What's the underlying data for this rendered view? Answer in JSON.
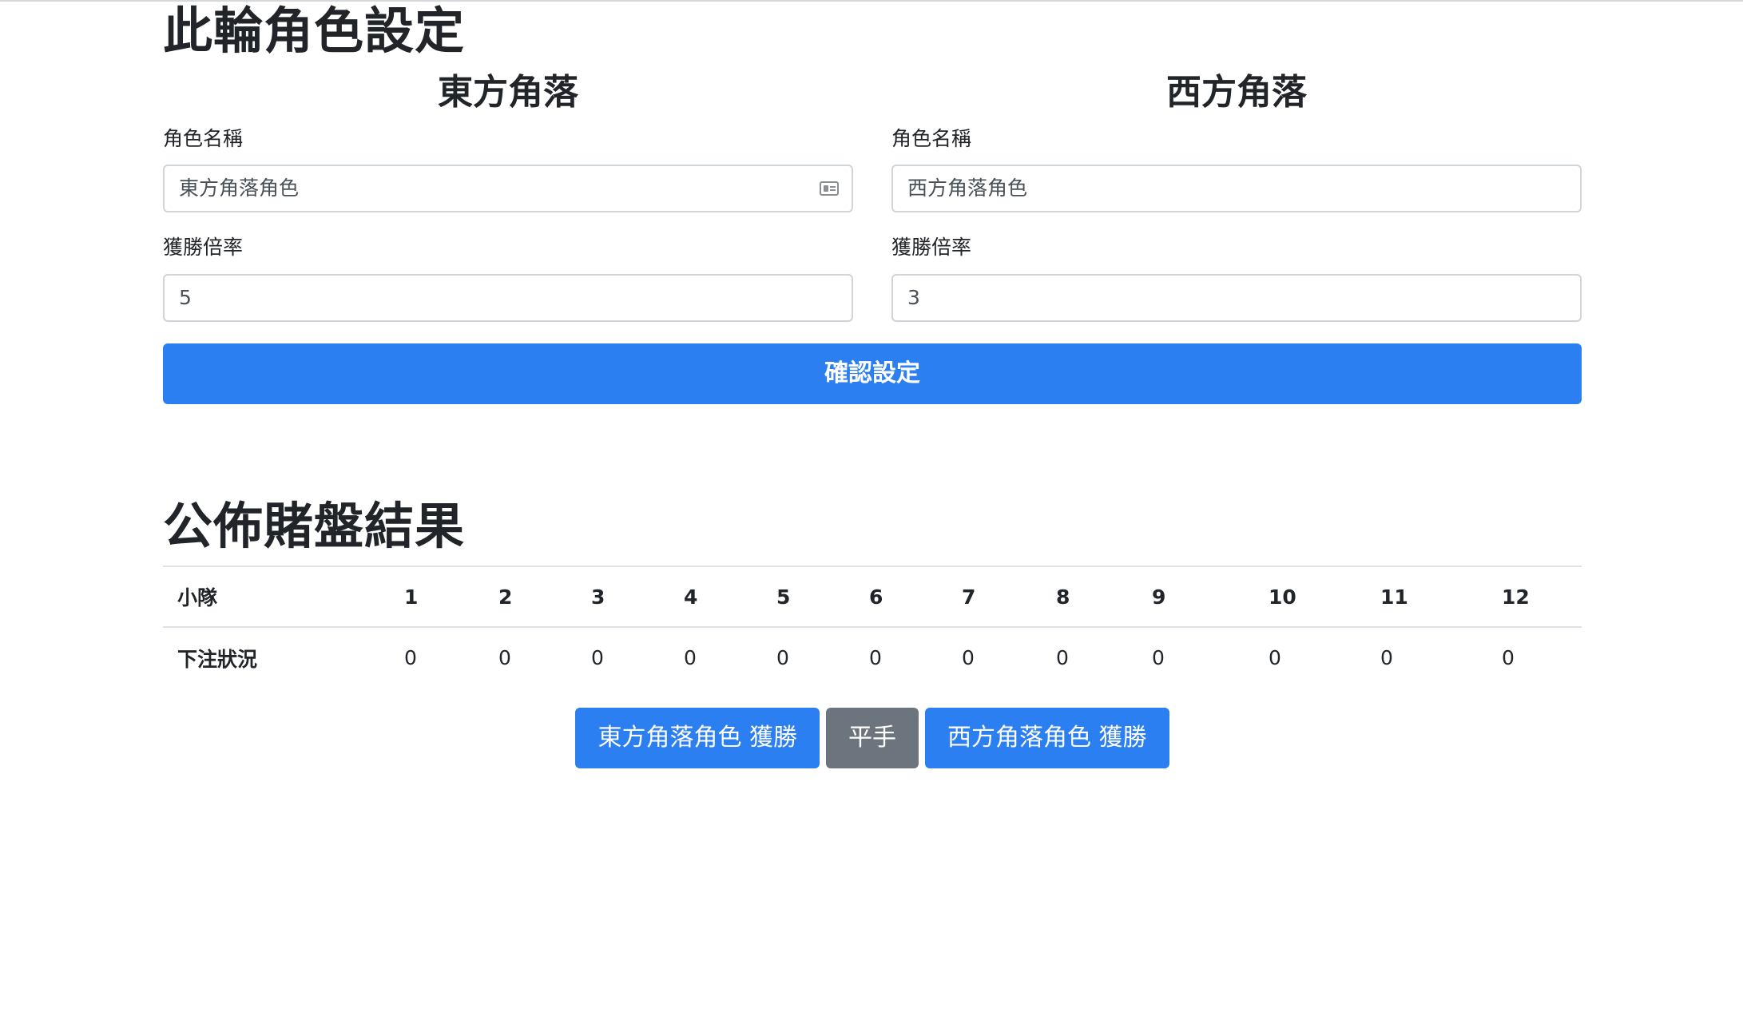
{
  "settings": {
    "title": "此輪角色設定",
    "confirm_label": "確認設定"
  },
  "east": {
    "heading": "東方角落",
    "name_label": "角色名稱",
    "name_value": "東方角落角色",
    "odds_label": "獲勝倍率",
    "odds_value": "5"
  },
  "west": {
    "heading": "西方角落",
    "name_label": "角色名稱",
    "name_value": "西方角落角色",
    "odds_label": "獲勝倍率",
    "odds_value": "3"
  },
  "results": {
    "title": "公佈賭盤結果",
    "header_label": "小隊",
    "row_label": "下注狀況",
    "teams": [
      "1",
      "2",
      "3",
      "4",
      "5",
      "6",
      "7",
      "8",
      "9",
      "10",
      "11",
      "12"
    ],
    "bets": [
      "0",
      "0",
      "0",
      "0",
      "0",
      "0",
      "0",
      "0",
      "0",
      "0",
      "0",
      "0"
    ],
    "east_win_label": "東方角落角色 獲勝",
    "draw_label": "平手",
    "west_win_label": "西方角落角色 獲勝"
  },
  "colors": {
    "primary": "#2c7ff0",
    "secondary": "#6c757d"
  },
  "icons": {
    "east_name_input": "contact-card-icon"
  }
}
